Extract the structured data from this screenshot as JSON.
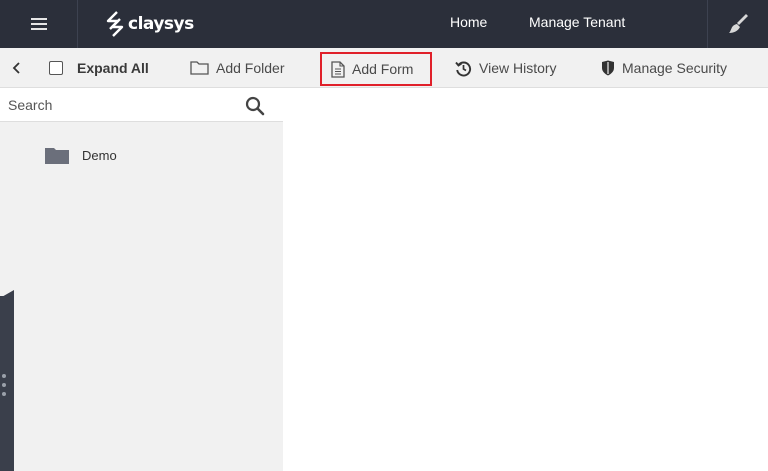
{
  "header": {
    "logo_text": "claysys",
    "nav": {
      "home": "Home",
      "manage_tenant": "Manage Tenant"
    },
    "background": "#2b2f3a"
  },
  "toolbar": {
    "expand_all": "Expand All",
    "add_folder": "Add Folder",
    "add_form": "Add Form",
    "view_history": "View History",
    "manage_security": "Manage Security",
    "highlight_color": "#e0202a"
  },
  "sidebar": {
    "search": {
      "placeholder": "Search",
      "value": ""
    },
    "tree": [
      {
        "label": "Demo",
        "icon": "folder-icon"
      }
    ]
  }
}
